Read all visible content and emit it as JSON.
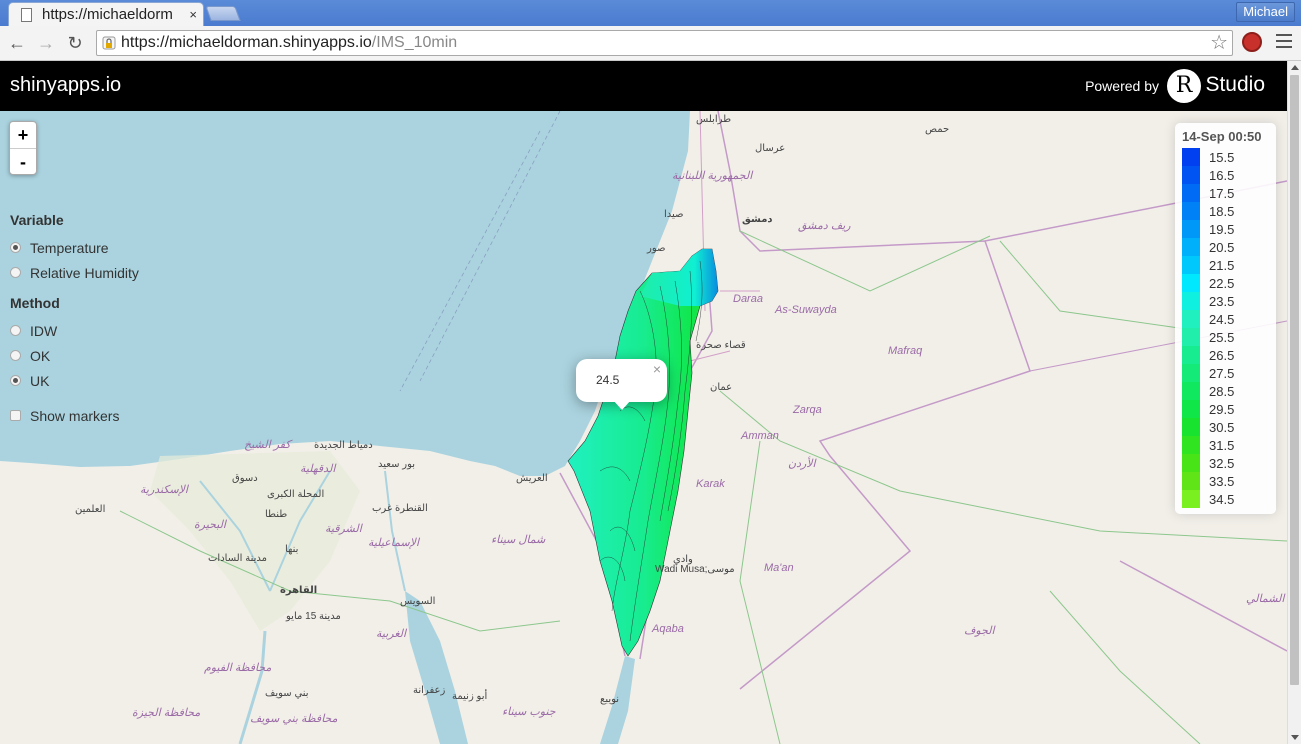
{
  "browser": {
    "tab_title": "https://michaeldorm",
    "tab_close": "×",
    "profile_name": "Michael",
    "url_scheme_host": "https://michaeldorman.shinyapps.io",
    "url_path": "/IMS_10min"
  },
  "app": {
    "brand": "shinyapps.io",
    "powered_by": "Powered by",
    "r_logo": "R",
    "studio": "Studio"
  },
  "zoom": {
    "in": "+",
    "out": "-"
  },
  "controls": {
    "variable_heading": "Variable",
    "variable_options": [
      "Temperature",
      "Relative Humidity"
    ],
    "variable_selected": "Temperature",
    "method_heading": "Method",
    "method_options": [
      "IDW",
      "OK",
      "UK"
    ],
    "method_selected": "UK",
    "show_markers_label": "Show markers",
    "show_markers_checked": false
  },
  "legend": {
    "title": "14-Sep 00:50",
    "entries": [
      {
        "label": "15.5",
        "color": "#0040f0"
      },
      {
        "label": "16.5",
        "color": "#0055f2"
      },
      {
        "label": "17.5",
        "color": "#006bf4"
      },
      {
        "label": "18.5",
        "color": "#0082f6"
      },
      {
        "label": "19.5",
        "color": "#0098f8"
      },
      {
        "label": "20.5",
        "color": "#00b0fa"
      },
      {
        "label": "21.5",
        "color": "#00c8fc"
      },
      {
        "label": "22.5",
        "color": "#00e8fd"
      },
      {
        "label": "23.5",
        "color": "#10f0e0"
      },
      {
        "label": "24.5",
        "color": "#20f0c0"
      },
      {
        "label": "25.5",
        "color": "#20eeaa"
      },
      {
        "label": "26.5",
        "color": "#18ec90"
      },
      {
        "label": "27.5",
        "color": "#14ea78"
      },
      {
        "label": "28.5",
        "color": "#10e860"
      },
      {
        "label": "29.5",
        "color": "#10e648"
      },
      {
        "label": "30.5",
        "color": "#18e430"
      },
      {
        "label": "31.5",
        "color": "#30e420"
      },
      {
        "label": "32.5",
        "color": "#48e418"
      },
      {
        "label": "33.5",
        "color": "#60e418"
      },
      {
        "label": "34.5",
        "color": "#7af020"
      }
    ]
  },
  "popup": {
    "value": "24.5",
    "close": "×"
  },
  "map_labels": [
    {
      "text": "طرابلس"
    },
    {
      "text": "عرسال"
    },
    {
      "text": "حمص"
    },
    {
      "text": "الجمهورية اللبنانية"
    },
    {
      "text": "صيدا"
    },
    {
      "text": "دمشق"
    },
    {
      "text": "ريف دمشق"
    },
    {
      "text": "صور"
    },
    {
      "text": "Daraa"
    },
    {
      "text": "As-Suwayda"
    },
    {
      "text": "Mafraq"
    },
    {
      "text": "قصاء صحرة"
    },
    {
      "text": "عمان"
    },
    {
      "text": "Zarqa"
    },
    {
      "text": "Amman"
    },
    {
      "text": "الأردن"
    },
    {
      "text": "Karak"
    },
    {
      "text": "كفر الشيخ"
    },
    {
      "text": "دمياط الجديدة"
    },
    {
      "text": "الدقهلية"
    },
    {
      "text": "بور سعيد"
    },
    {
      "text": "العريش"
    },
    {
      "text": "الإسكندرية"
    },
    {
      "text": "دسوق"
    },
    {
      "text": "المحلة الكبرى"
    },
    {
      "text": "القنطرة غرب"
    },
    {
      "text": "العلمين"
    },
    {
      "text": "طنطا"
    },
    {
      "text": "البحيرة"
    },
    {
      "text": "الشرقية"
    },
    {
      "text": "الإسماعيلية"
    },
    {
      "text": "شمال سيناء"
    },
    {
      "text": "بنها"
    },
    {
      "text": "مدينة السادات"
    },
    {
      "text": "وادي"
    },
    {
      "text": "Wadi Musa;موسى"
    },
    {
      "text": "Ma'an"
    },
    {
      "text": "القاهرة"
    },
    {
      "text": "مدينة 15 مايو"
    },
    {
      "text": "السويس"
    },
    {
      "text": "Aqaba"
    },
    {
      "text": "الجوف"
    },
    {
      "text": "الغربية"
    },
    {
      "text": "محافظة الفيوم"
    },
    {
      "text": "بني سويف"
    },
    {
      "text": "زعفرانة"
    },
    {
      "text": "أبو زنيمة"
    },
    {
      "text": "جنوب سيناء"
    },
    {
      "text": "نويبع"
    },
    {
      "text": "محافظة الجيزة"
    },
    {
      "text": "محافظة بني سويف"
    },
    {
      "text": "الشمالي"
    }
  ]
}
